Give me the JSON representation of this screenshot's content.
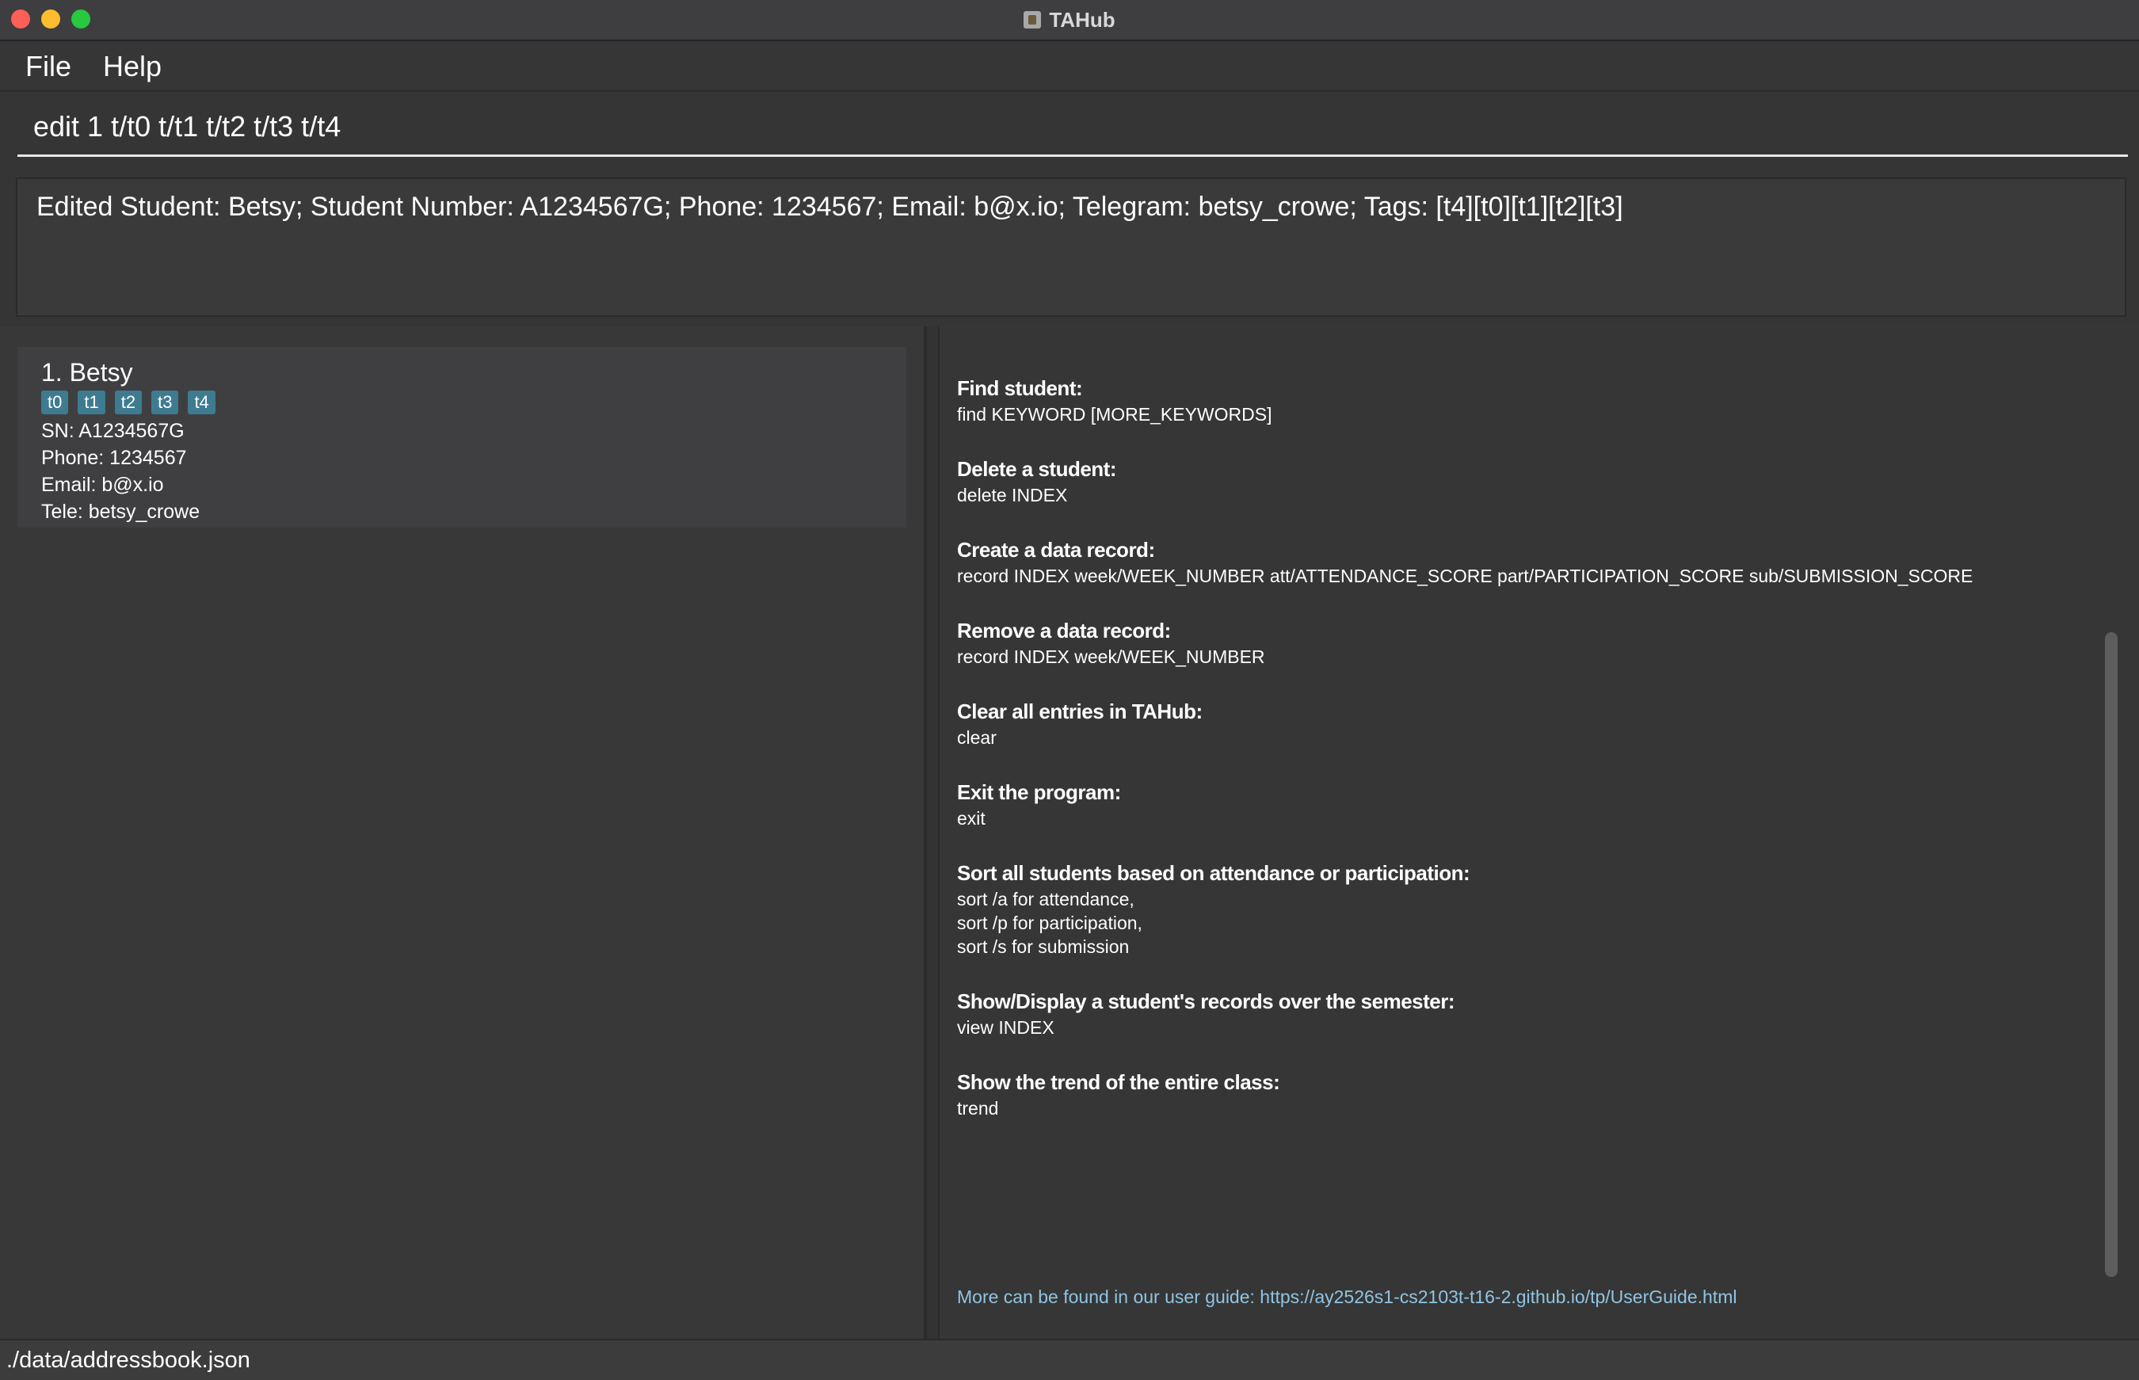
{
  "window": {
    "title": "TAHub"
  },
  "menu": {
    "file": "File",
    "help": "Help"
  },
  "command": {
    "value": "edit 1 t/t0 t/t1 t/t2 t/t3 t/t4"
  },
  "result": {
    "text": "Edited Student: Betsy; Student Number: A1234567G; Phone: 1234567; Email: b@x.io; Telegram: betsy_crowe; Tags: [t4][t0][t1][t2][t3]"
  },
  "student": {
    "name": "1. Betsy",
    "tags": [
      "t0",
      "t1",
      "t2",
      "t3",
      "t4"
    ],
    "sn": "SN: A1234567G",
    "phone": "Phone: 1234567",
    "email": "Email: b@x.io",
    "tele": "Tele: betsy_crowe"
  },
  "help": {
    "sections": [
      {
        "heading": "Find student:",
        "lines": [
          "find KEYWORD [MORE_KEYWORDS]"
        ]
      },
      {
        "heading": "Delete a student:",
        "lines": [
          "delete INDEX"
        ]
      },
      {
        "heading": "Create a data record:",
        "lines": [
          "record INDEX week/WEEK_NUMBER att/ATTENDANCE_SCORE part/PARTICIPATION_SCORE sub/SUBMISSION_SCORE"
        ]
      },
      {
        "heading": "Remove a data record:",
        "lines": [
          "record INDEX week/WEEK_NUMBER"
        ]
      },
      {
        "heading": "Clear all entries in TAHub:",
        "lines": [
          "clear"
        ]
      },
      {
        "heading": "Exit the program:",
        "lines": [
          "exit"
        ]
      },
      {
        "heading": "Sort all students based on attendance or participation:",
        "lines": [
          "sort /a for attendance,",
          "sort /p for participation,",
          "sort /s for submission"
        ]
      },
      {
        "heading": "Show/Display a student's records over the semester:",
        "lines": [
          "view INDEX"
        ]
      },
      {
        "heading": "Show the trend of the entire class:",
        "lines": [
          "trend"
        ]
      }
    ],
    "footer": "More can be found in our user guide: https://ay2526s1-cs2103t-t16-2.github.io/tp/UserGuide.html"
  },
  "status": {
    "path": "./data/addressbook.json"
  }
}
